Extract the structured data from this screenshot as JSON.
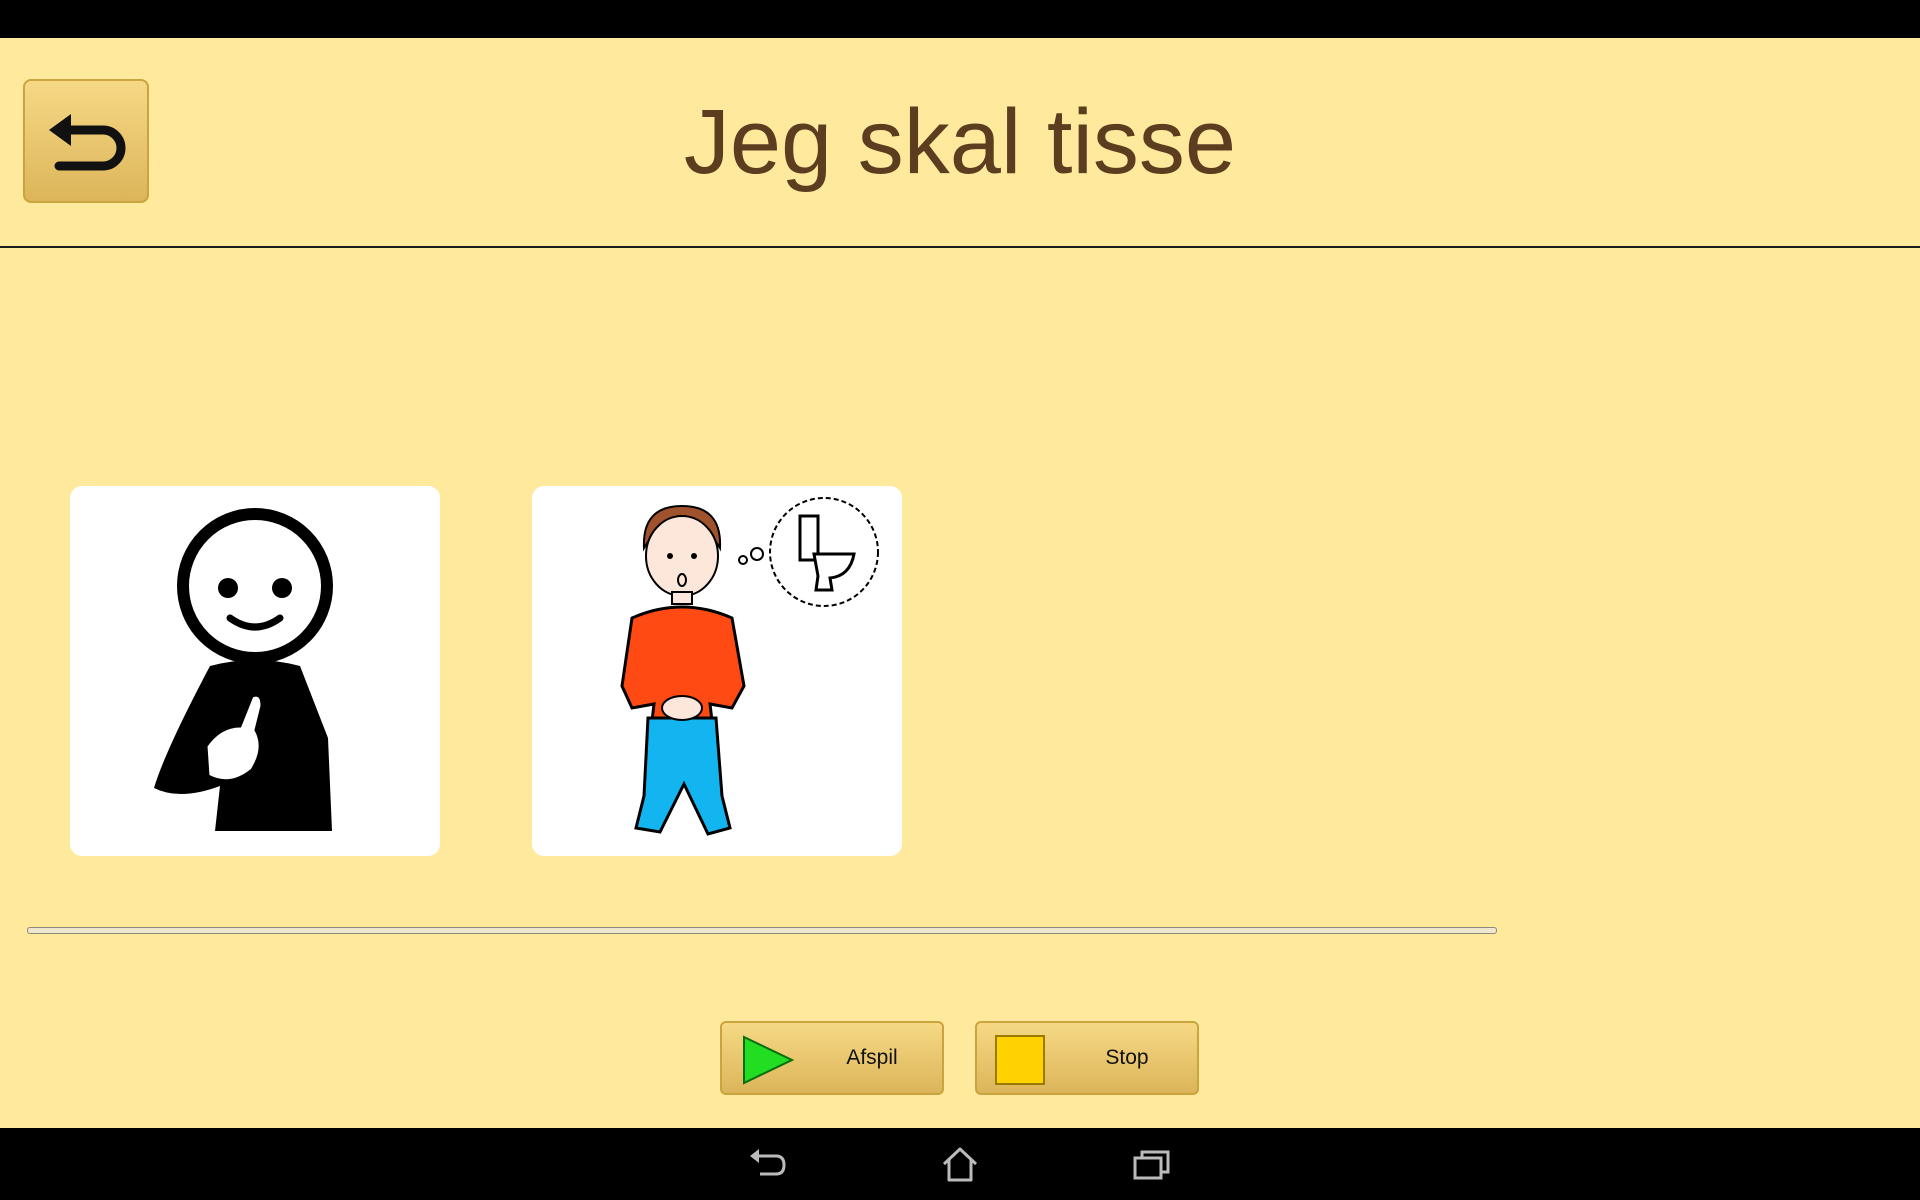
{
  "header": {
    "title": "Jeg skal tisse",
    "back_icon": "return-arrow-icon"
  },
  "cards": [
    {
      "icon": "person-pointing-self-pictogram"
    },
    {
      "icon": "boy-needs-toilet-pictogram"
    }
  ],
  "progress": {
    "value_percent": 0
  },
  "controls": {
    "play_label": "Afspil",
    "play_icon": "play-triangle-icon",
    "play_color": "#22dd22",
    "stop_label": "Stop",
    "stop_icon": "stop-square-icon",
    "stop_color": "#ffd200"
  },
  "system_nav": {
    "back_icon": "nav-back-icon",
    "home_icon": "nav-home-icon",
    "recent_icon": "nav-recent-apps-icon"
  },
  "colors": {
    "background": "#fee99c",
    "title_text": "#5c3d1f",
    "button_gold": "#e8c56e"
  }
}
